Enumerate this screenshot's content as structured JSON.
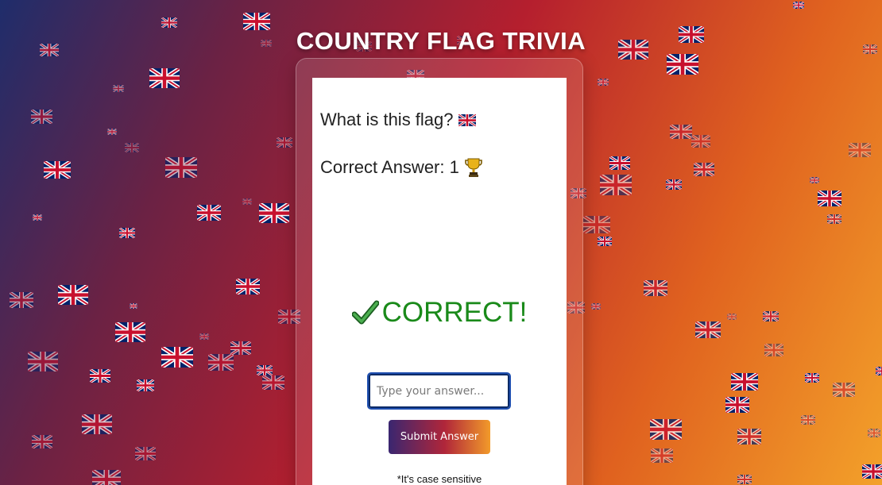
{
  "app": {
    "title": "COUNTRY FLAG TRIVIA"
  },
  "quiz": {
    "question_label": "What is this flag?",
    "question_flag_icon": "united-kingdom-flag-icon",
    "score_label": "Correct Answer: 1",
    "score_icon": "trophy-icon",
    "feedback_text": "CORRECT!",
    "feedback_icon": "check-mark-icon",
    "feedback_color": "#1a8a1a"
  },
  "form": {
    "answer_placeholder": "Type your answer...",
    "answer_value": "",
    "submit_label": "Submit Answer",
    "note": "*It's case sensitive"
  },
  "background": {
    "decoration_icon": "united-kingdom-flag-icon",
    "colors": [
      "#1f2d6b",
      "#b51f2e",
      "#e0621f",
      "#f3a12a"
    ]
  }
}
